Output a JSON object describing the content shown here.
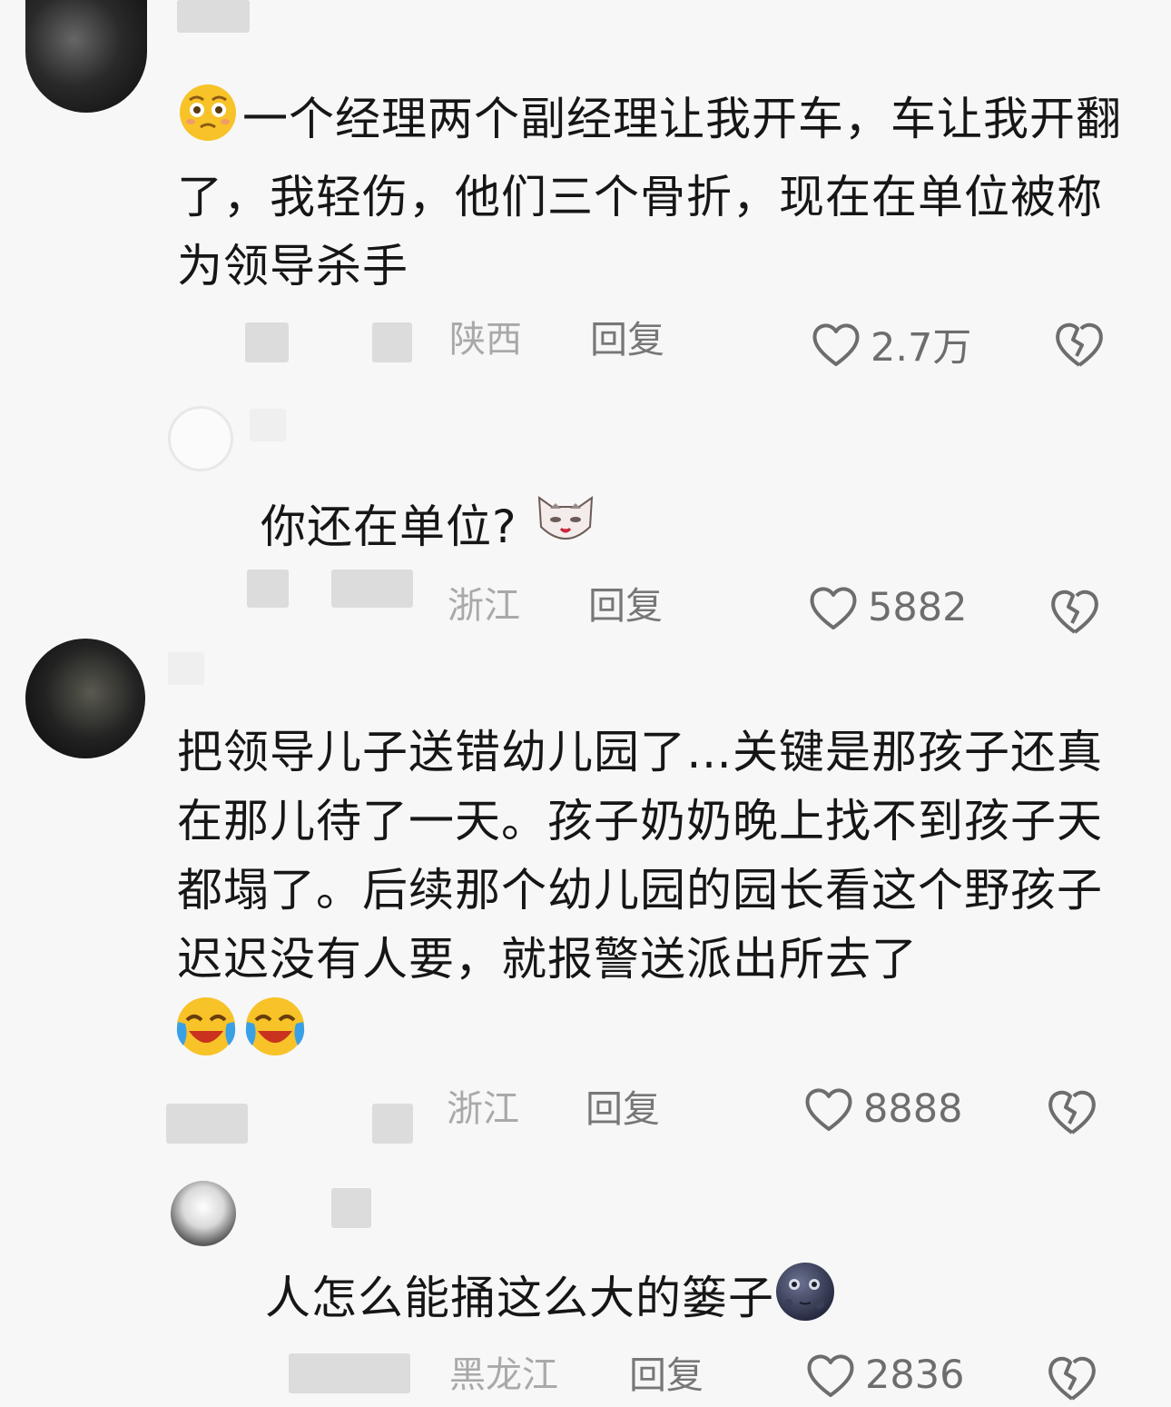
{
  "comments": [
    {
      "text": "一个经理两个副经理让我开车，车让我开翻了，我轻伤，他们三个骨折，现在在单位被称为领导杀手",
      "location": "陕西",
      "reply_label": "回复",
      "likes": "2.7万",
      "emoji": "pleading-face"
    },
    {
      "text": "你还在单位?",
      "location": "浙江",
      "reply_label": "回复",
      "likes": "5882",
      "emoji": "cat-face"
    },
    {
      "text": "把领导儿子送错幼儿园了…关键是那孩子还真在那儿待了一天。孩子奶奶晚上找不到孩子天都塌了。后续那个幼儿园的园长看这个野孩子迟迟没有人要，就报警送派出所去了",
      "location": "浙江",
      "reply_label": "回复",
      "likes": "8888",
      "emoji": "crying-laughing-face"
    },
    {
      "text": "人怎么能捅这么大的篓子",
      "location": "黑龙江",
      "reply_label": "回复",
      "likes": "2836",
      "emoji": "dark-moon-face"
    }
  ],
  "icons": {
    "like": "heart-outline-icon",
    "dislike": "broken-heart-icon"
  },
  "colors": {
    "text": "#161616",
    "meta": "#a9a9a9",
    "emoji_yellow": "#f7c328"
  }
}
